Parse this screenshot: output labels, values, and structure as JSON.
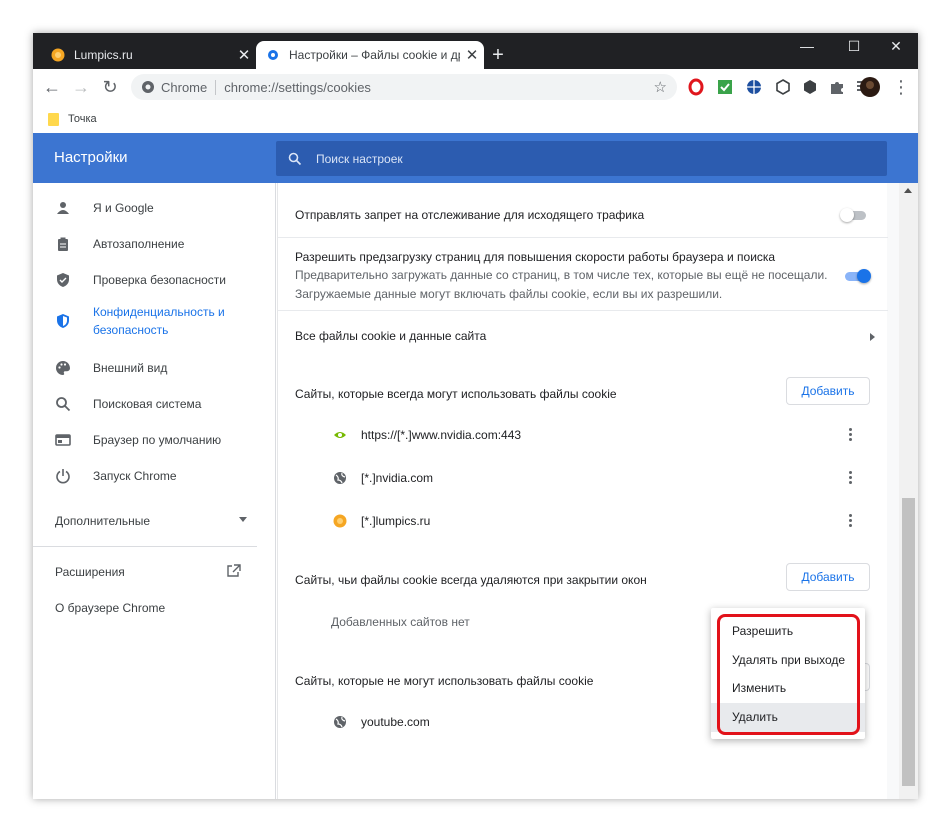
{
  "tabs": [
    {
      "title": "Lumpics.ru",
      "close": "✕"
    },
    {
      "title": "Настройки – Файлы cookie и др",
      "close": "✕"
    }
  ],
  "new_tab": "+",
  "window_controls": {
    "minimize": "—",
    "maximize": "☐",
    "close": "✕"
  },
  "toolbar": {
    "back": "←",
    "forward": "→",
    "reload": "↻",
    "star": "☆",
    "menu": "⋮"
  },
  "omnibox": {
    "chip": "Chrome",
    "url": "chrome://settings/cookies"
  },
  "extensions": [
    "opera-icon",
    "check-icon",
    "globe-vpn-icon",
    "cube-icon",
    "cube-outline-icon",
    "puzzle-icon",
    "media-playlist-icon",
    "avatar-icon"
  ],
  "bookmarks": [
    {
      "label": "Точка"
    }
  ],
  "header": {
    "title": "Настройки",
    "search_placeholder": "Поиск настроек"
  },
  "sidebar": {
    "items": [
      {
        "label": "Я и Google",
        "icon": "person-icon"
      },
      {
        "label": "Автозаполнение",
        "icon": "clipboard-icon"
      },
      {
        "label": "Проверка безопасности",
        "icon": "shield-check-icon"
      },
      {
        "label": "Конфиденциальность и безопасность",
        "line1": "Конфиденциальность и",
        "line2": "безопасность",
        "icon": "shield-icon",
        "active": true
      },
      {
        "label": "Внешний вид",
        "icon": "palette-icon"
      },
      {
        "label": "Поисковая система",
        "icon": "search-icon"
      },
      {
        "label": "Браузер по умолчанию",
        "icon": "browser-icon"
      },
      {
        "label": "Запуск Chrome",
        "icon": "power-icon"
      }
    ],
    "advanced": "Дополнительные",
    "extensions": "Расширения",
    "about": "О браузере Chrome"
  },
  "main": {
    "dnt": {
      "label": "Отправлять запрет на отслеживание для исходящего трафика",
      "enabled": false
    },
    "preload": {
      "label": "Разрешить предзагрузку страниц для повышения скорости работы браузера и поиска",
      "desc1": "Предварительно загружать данные со страниц, в том числе тех, которые вы ещё не посещали.",
      "desc2": "Загружаемые данные могут включать файлы cookie, если вы их разрешили.",
      "enabled": true
    },
    "all_cookies": "Все файлы cookie и данные сайта",
    "allow": {
      "heading": "Сайты, которые всегда могут использовать файлы cookie",
      "add_label": "Добавить",
      "sites": [
        {
          "url": "https://[*.]www.nvidia.com:443",
          "icon": "nvidia-icon"
        },
        {
          "url": "[*.]nvidia.com",
          "icon": "globe-icon"
        },
        {
          "url": "[*.]lumpics.ru",
          "icon": "orange-icon"
        }
      ]
    },
    "clear_on_exit": {
      "heading": "Сайты, чьи файлы cookie всегда удаляются при закрытии окон",
      "add_label": "Добавить",
      "empty": "Добавленных сайтов нет"
    },
    "block": {
      "heading": "Сайты, которые не могут использовать файлы cookie",
      "sites": [
        {
          "url": "youtube.com",
          "icon": "globe-icon"
        }
      ]
    }
  },
  "context_menu": {
    "items": [
      "Разрешить",
      "Удалять при выходе",
      "Изменить",
      "Удалить"
    ],
    "hovered": "Удалить"
  },
  "colors": {
    "accent": "#1a73e8",
    "header": "#3c75d1",
    "highlight": "#e2121a"
  }
}
